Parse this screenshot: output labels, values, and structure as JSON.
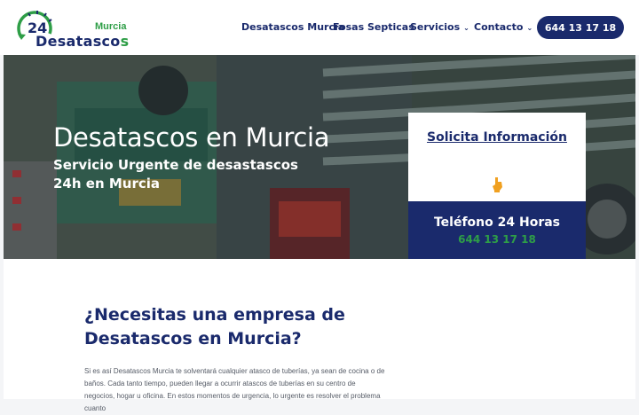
{
  "logo": {
    "number": "24",
    "city": "Murcia",
    "word_main": "Desatasco",
    "word_last": "s"
  },
  "nav": {
    "items": [
      {
        "label": "Desatascos Murcia"
      },
      {
        "label": "Fosas Septicas"
      },
      {
        "label": "Servicios",
        "chevron": "⌄"
      },
      {
        "label": "Contacto",
        "chevron": "⌄"
      }
    ],
    "phone_button": "644 13 17 18"
  },
  "hero": {
    "title": "Desatascos en Murcia",
    "subtitle": "Servicio Urgente de desastascos 24h en Murcia"
  },
  "info_card": {
    "link": "Solicita Información",
    "icon": "hand-pointer-icon",
    "tel_title": "Teléfono 24 Horas",
    "tel_number": "644 13 17 18"
  },
  "section": {
    "title": "¿Necesitas una empresa de Desatascos en Murcia?",
    "body": "Si es así Desatascos Murcia te solventará cualquier atasco de tuberías, ya sean de cocina o de baños. Cada tanto tiempo, pueden llegar a ocurrir atascos de tuberías en su centro de negocios, hogar u oficina. En estos momentos de urgencia, lo urgente es resolver el problema cuanto"
  },
  "colors": {
    "navy": "#1a2a6c",
    "green": "#2e9e47",
    "accent_orange": "#f0a020"
  }
}
